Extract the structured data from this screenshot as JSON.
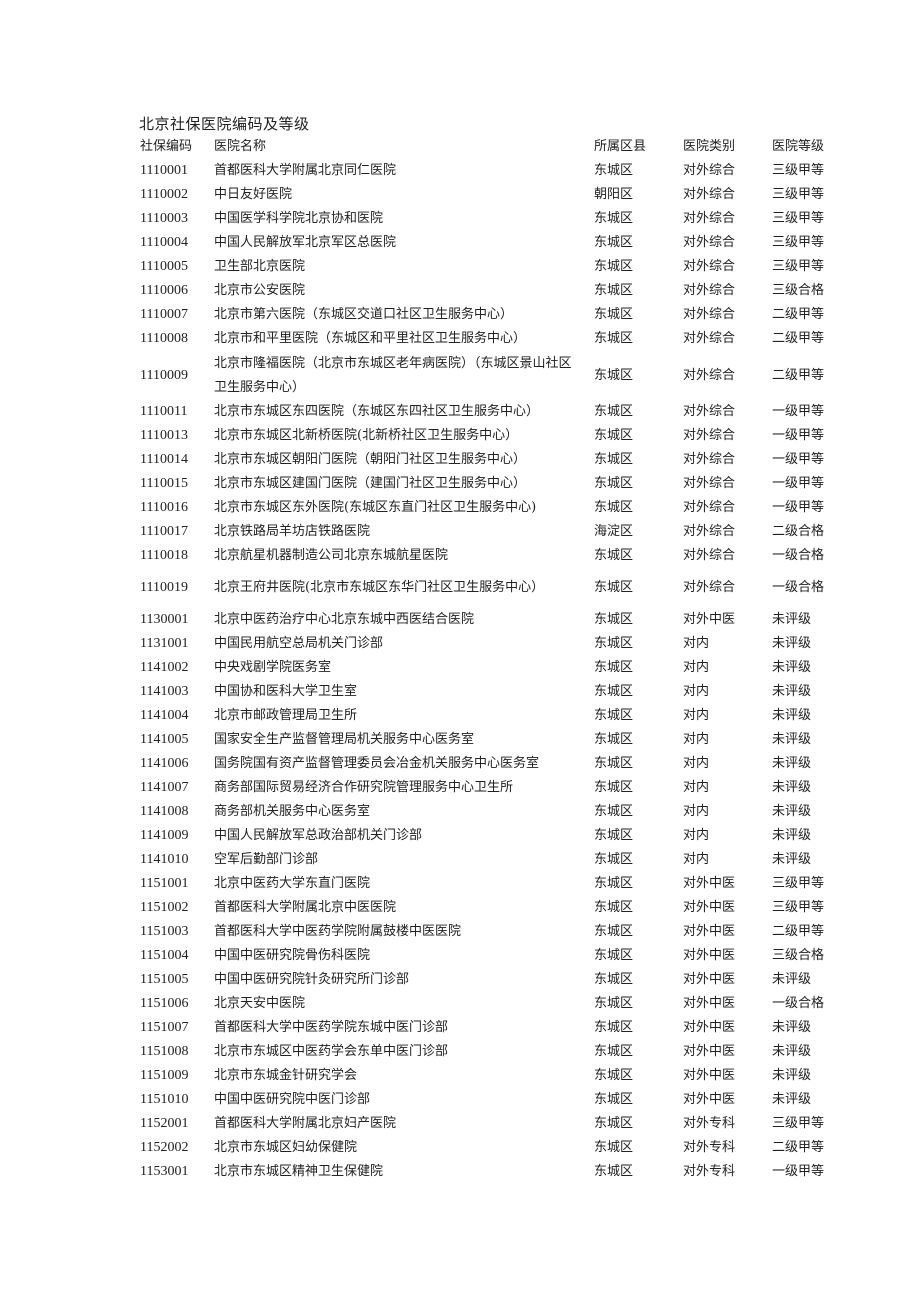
{
  "document": {
    "title": "北京社保医院编码及等级",
    "columns": {
      "code": "社保编码",
      "name": "医院名称",
      "district": "所属区县",
      "type": "医院类别",
      "grade": "医院等级"
    },
    "rows": [
      {
        "code": "1110001",
        "name": "首都医科大学附属北京同仁医院",
        "district": "东城区",
        "type": "对外综合",
        "grade": "三级甲等"
      },
      {
        "code": "1110002",
        "name": "中日友好医院",
        "district": "朝阳区",
        "type": "对外综合",
        "grade": "三级甲等"
      },
      {
        "code": "1110003",
        "name": "中国医学科学院北京协和医院",
        "district": "东城区",
        "type": "对外综合",
        "grade": "三级甲等"
      },
      {
        "code": "1110004",
        "name": "中国人民解放军北京军区总医院",
        "district": "东城区",
        "type": "对外综合",
        "grade": "三级甲等"
      },
      {
        "code": "1110005",
        "name": "卫生部北京医院",
        "district": "东城区",
        "type": "对外综合",
        "grade": "三级甲等"
      },
      {
        "code": "1110006",
        "name": "北京市公安医院",
        "district": "东城区",
        "type": "对外综合",
        "grade": "三级合格"
      },
      {
        "code": "1110007",
        "name": "北京市第六医院（东城区交道口社区卫生服务中心）",
        "district": "东城区",
        "type": "对外综合",
        "grade": "二级甲等"
      },
      {
        "code": "1110008",
        "name": "北京市和平里医院（东城区和平里社区卫生服务中心）",
        "district": "东城区",
        "type": "对外综合",
        "grade": "二级甲等"
      },
      {
        "code": "1110009",
        "name": "北京市隆福医院（北京市东城区老年病医院）（东城区景山社区卫生服务中心）",
        "district": "东城区",
        "type": "对外综合",
        "grade": "二级甲等"
      },
      {
        "code": "1110011",
        "name": "北京市东城区东四医院（东城区东四社区卫生服务中心）",
        "district": "东城区",
        "type": "对外综合",
        "grade": "一级甲等"
      },
      {
        "code": "1110013",
        "name": "北京市东城区北新桥医院(北新桥社区卫生服务中心）",
        "district": "东城区",
        "type": "对外综合",
        "grade": "一级甲等"
      },
      {
        "code": "1110014",
        "name": "北京市东城区朝阳门医院（朝阳门社区卫生服务中心）",
        "district": "东城区",
        "type": "对外综合",
        "grade": "一级甲等"
      },
      {
        "code": "1110015",
        "name": "北京市东城区建国门医院（建国门社区卫生服务中心）",
        "district": "东城区",
        "type": "对外综合",
        "grade": "一级甲等"
      },
      {
        "code": "1110016",
        "name": "北京市东城区东外医院(东城区东直门社区卫生服务中心)",
        "district": "东城区",
        "type": "对外综合",
        "grade": "一级甲等"
      },
      {
        "code": "1110017",
        "name": "北京铁路局羊坊店铁路医院",
        "district": "海淀区",
        "type": "对外综合",
        "grade": "二级合格"
      },
      {
        "code": "1110018",
        "name": "北京航星机器制造公司北京东城航星医院",
        "district": "东城区",
        "type": "对外综合",
        "grade": "一级合格"
      },
      {
        "code": "1110019",
        "name": "北京王府井医院(北京市东城区东华门社区卫生服务中心）",
        "district": "东城区",
        "type": "对外综合",
        "grade": "一级合格"
      },
      {
        "code": "1130001",
        "name": "北京中医药治疗中心北京东城中西医结合医院",
        "district": "东城区",
        "type": "对外中医",
        "grade": "未评级"
      },
      {
        "code": "1131001",
        "name": "中国民用航空总局机关门诊部",
        "district": "东城区",
        "type": "对内",
        "grade": "未评级"
      },
      {
        "code": "1141002",
        "name": "中央戏剧学院医务室",
        "district": "东城区",
        "type": "对内",
        "grade": "未评级"
      },
      {
        "code": "1141003",
        "name": "中国协和医科大学卫生室",
        "district": "东城区",
        "type": "对内",
        "grade": "未评级"
      },
      {
        "code": "1141004",
        "name": "北京市邮政管理局卫生所",
        "district": "东城区",
        "type": "对内",
        "grade": "未评级"
      },
      {
        "code": "1141005",
        "name": "国家安全生产监督管理局机关服务中心医务室",
        "district": "东城区",
        "type": "对内",
        "grade": "未评级"
      },
      {
        "code": "1141006",
        "name": "国务院国有资产监督管理委员会冶金机关服务中心医务室",
        "district": "东城区",
        "type": "对内",
        "grade": "未评级"
      },
      {
        "code": "1141007",
        "name": "商务部国际贸易经济合作研究院管理服务中心卫生所",
        "district": "东城区",
        "type": "对内",
        "grade": "未评级"
      },
      {
        "code": "1141008",
        "name": "商务部机关服务中心医务室",
        "district": "东城区",
        "type": "对内",
        "grade": "未评级"
      },
      {
        "code": "1141009",
        "name": "中国人民解放军总政治部机关门诊部",
        "district": "东城区",
        "type": "对内",
        "grade": "未评级"
      },
      {
        "code": "1141010",
        "name": "空军后勤部门诊部",
        "district": "东城区",
        "type": "对内",
        "grade": "未评级"
      },
      {
        "code": "1151001",
        "name": "北京中医药大学东直门医院",
        "district": "东城区",
        "type": "对外中医",
        "grade": "三级甲等"
      },
      {
        "code": "1151002",
        "name": "首都医科大学附属北京中医医院",
        "district": "东城区",
        "type": "对外中医",
        "grade": "三级甲等"
      },
      {
        "code": "1151003",
        "name": "首都医科大学中医药学院附属鼓楼中医医院",
        "district": "东城区",
        "type": "对外中医",
        "grade": "二级甲等"
      },
      {
        "code": "1151004",
        "name": "中国中医研究院骨伤科医院",
        "district": "东城区",
        "type": "对外中医",
        "grade": "三级合格"
      },
      {
        "code": "1151005",
        "name": "中国中医研究院针灸研究所门诊部",
        "district": "东城区",
        "type": "对外中医",
        "grade": "未评级"
      },
      {
        "code": "1151006",
        "name": "北京天安中医院",
        "district": "东城区",
        "type": "对外中医",
        "grade": "一级合格"
      },
      {
        "code": "1151007",
        "name": "首都医科大学中医药学院东城中医门诊部",
        "district": "东城区",
        "type": "对外中医",
        "grade": "未评级"
      },
      {
        "code": "1151008",
        "name": "北京市东城区中医药学会东单中医门诊部",
        "district": "东城区",
        "type": "对外中医",
        "grade": "未评级"
      },
      {
        "code": "1151009",
        "name": "北京市东城金针研究学会",
        "district": "东城区",
        "type": "对外中医",
        "grade": "未评级"
      },
      {
        "code": "1151010",
        "name": "中国中医研究院中医门诊部",
        "district": "东城区",
        "type": "对外中医",
        "grade": "未评级"
      },
      {
        "code": "1152001",
        "name": "首都医科大学附属北京妇产医院",
        "district": "东城区",
        "type": "对外专科",
        "grade": "三级甲等"
      },
      {
        "code": "1152002",
        "name": "北京市东城区妇幼保健院",
        "district": "东城区",
        "type": "对外专科",
        "grade": "二级甲等"
      },
      {
        "code": "1153001",
        "name": "北京市东城区精神卫生保健院",
        "district": "东城区",
        "type": "对外专科",
        "grade": "一级甲等"
      }
    ]
  }
}
